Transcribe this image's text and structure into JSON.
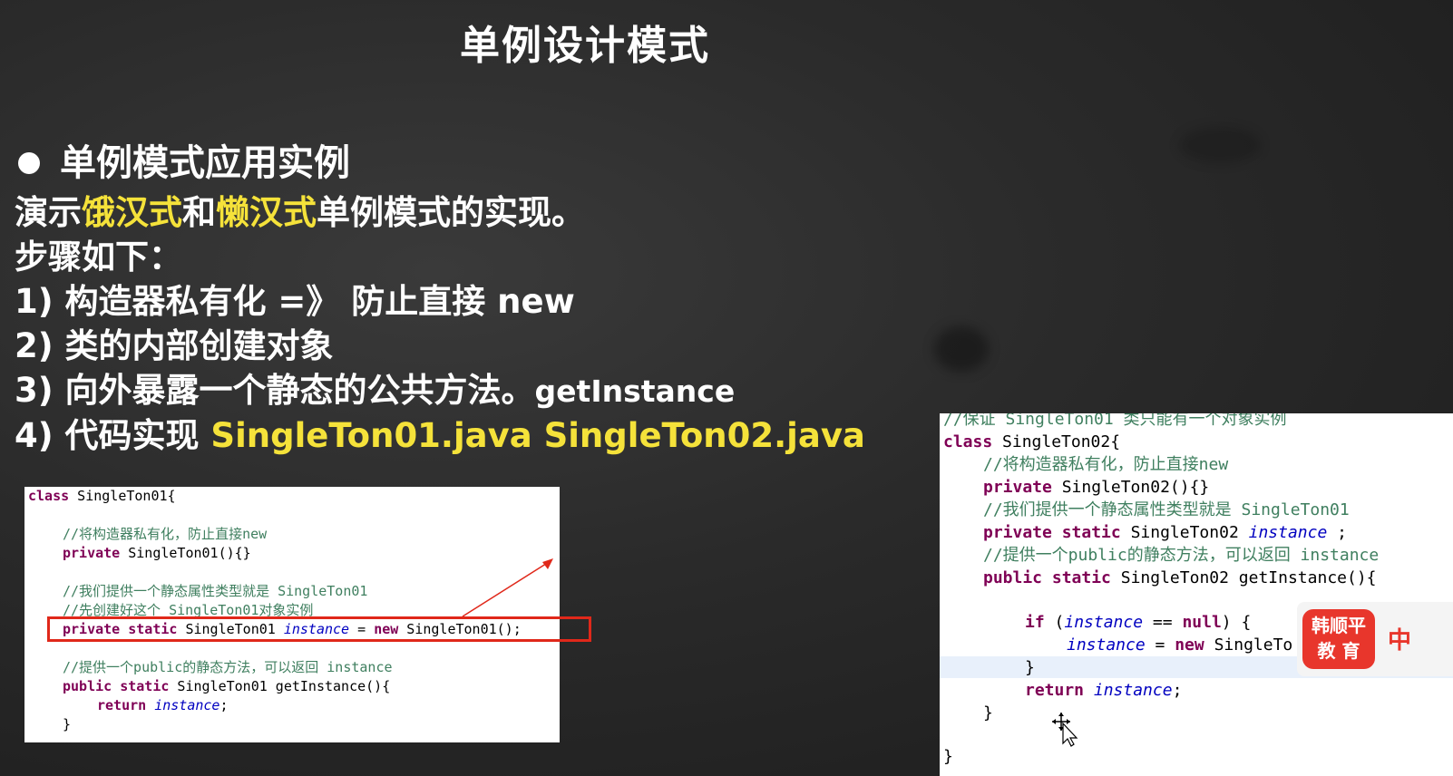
{
  "slide": {
    "title": "单例设计模式",
    "heading": "单例模式应用实例",
    "intro": {
      "prefix": "演示",
      "hl1": "饿汉式",
      "mid": "和",
      "hl2": "懒汉式",
      "suffix": "单例模式的实现。"
    },
    "steps_title": "步骤如下：",
    "step1": "1) 构造器私有化 =》 防止直接 new",
    "step2": "2) 类的内部创建对象",
    "step3_text": "3) 向外暴露一个静态的公共方法。",
    "step3_code": "getInstance",
    "step4_text": "4) 代码实现 ",
    "step4_files": "SingleTon01.java SingleTon02.java",
    "highlight_color": "#f5e23a"
  },
  "code1": {
    "l1_kw": "class",
    "l1_name": " SingleTon01{",
    "c1": "//将构造器私有化，防止直接new",
    "l2_kw": "private",
    "l2_rest": " SingleTon01(){}",
    "c2": "//我们提供一个静态属性类型就是 SingleTon01",
    "c3": "//先创建好这个 SingleTon01对象实例",
    "l3_kw1": "private",
    "l3_kw2": "static",
    "l3_type": " SingleTon01 ",
    "l3_var": "instance",
    "l3_eq": " = ",
    "l3_new": "new",
    "l3_rest": " SingleTon01();",
    "c4": "//提供一个public的静态方法，可以返回 instance",
    "l4_kw1": "public",
    "l4_kw2": "static",
    "l4_rest": " SingleTon01 getInstance(){",
    "l5_kw": "return",
    "l5_var": "instance",
    "l5_end": ";",
    "l6": "}"
  },
  "code2": {
    "c0": "//保证 SingleTon01 类只能有一个对象实例",
    "l1_kw": "class",
    "l1_name": " SingleTon02{",
    "c1": "//将构造器私有化，防止直接new",
    "l2_kw": "private",
    "l2_rest": " SingleTon02(){}",
    "c2": "//我们提供一个静态属性类型就是 SingleTon01",
    "l3_kw1": "private",
    "l3_kw2": "static",
    "l3_type": " SingleTon02 ",
    "l3_var": "instance",
    "l3_end": " ;",
    "c3": "//提供一个public的静态方法，可以返回 instance",
    "l4_kw1": "public",
    "l4_kw2": "static",
    "l4_rest": " SingleTon02 getInstance(){",
    "l5_kw": "if",
    "l5_open": " (",
    "l5_var": "instance",
    "l5_eq": " == ",
    "l5_null": "null",
    "l5_close": ") {",
    "l6_var": "instance",
    "l6_eq": " = ",
    "l6_new": "new",
    "l6_rest": " SingleTo",
    "l7": "}",
    "l8_kw": "return",
    "l8_var": "instance",
    "l8_end": ";",
    "l9": "}",
    "l10": "}"
  },
  "logo": {
    "line1": "韩顺平",
    "line2": "教 育",
    "side": "中"
  }
}
